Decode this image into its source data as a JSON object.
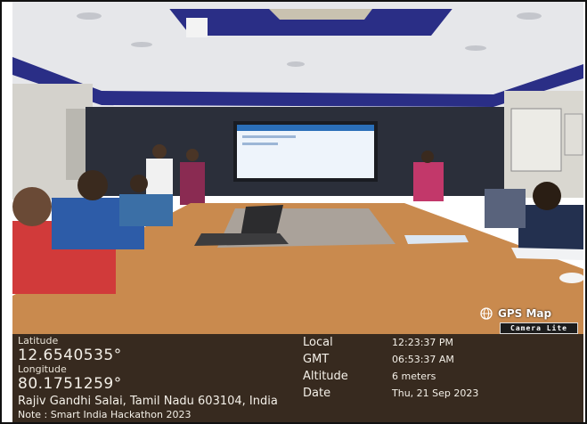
{
  "badge": {
    "title": "GPS Map",
    "subtitle": "Camera Lite",
    "icon": "globe-icon"
  },
  "coords": {
    "latitude_label": "Latitude",
    "latitude_value": "12.6540535°",
    "longitude_label": "Longitude",
    "longitude_value": "80.1751259°"
  },
  "info": {
    "local_label": "Local",
    "local_value": "12:23:37 PM",
    "gmt_label": "GMT",
    "gmt_value": "06:53:37 AM",
    "altitude_label": "Altitude",
    "altitude_value": "6 meters",
    "date_label": "Date",
    "date_value": "Thu, 21 Sep 2023"
  },
  "address": "Rajiv Gandhi Salai, Tamil Nadu 603104, India",
  "note": "Note : Smart India Hackathon 2023",
  "colors": {
    "overlay_bg": "#26180c",
    "ceiling_band": "#2a2e86",
    "table": "#c98a4e"
  }
}
